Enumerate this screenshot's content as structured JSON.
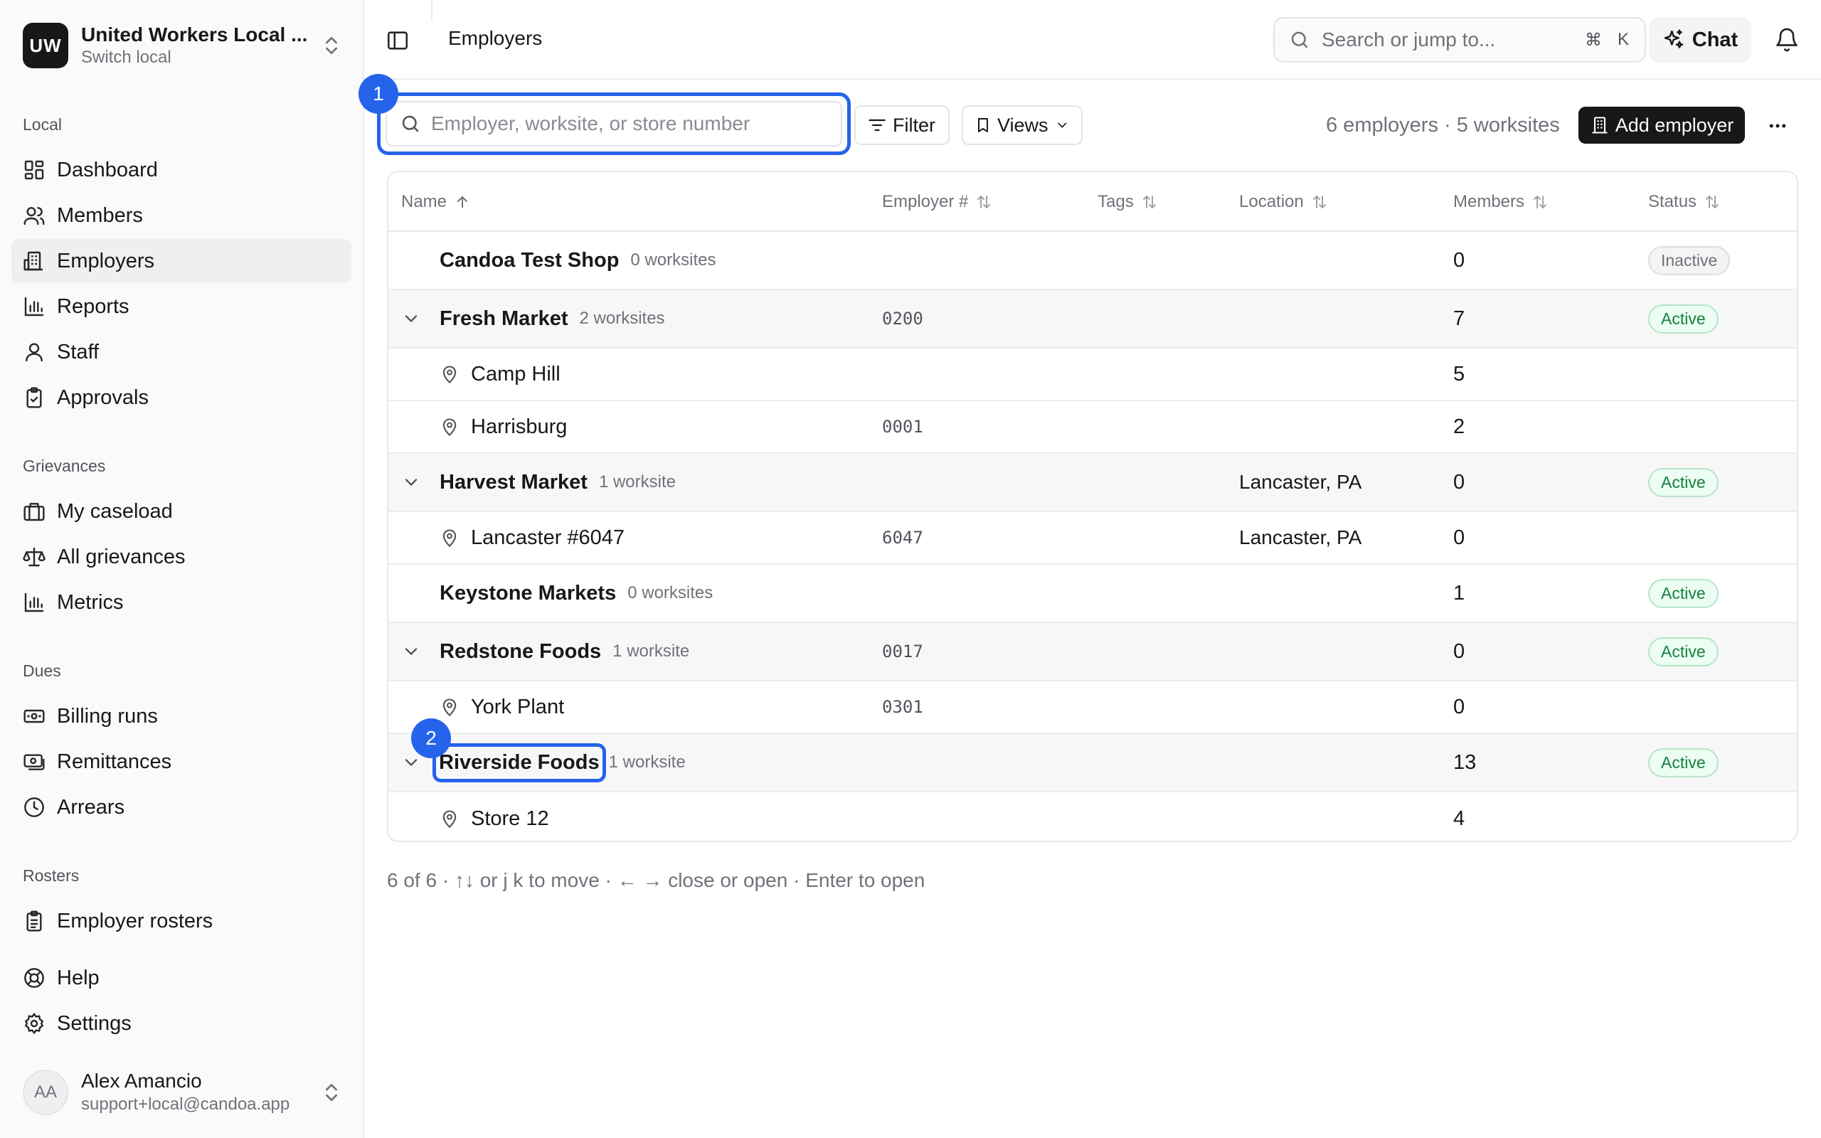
{
  "sidebar": {
    "org": {
      "logo_text": "UW",
      "name": "United Workers Local ...",
      "subtitle": "Switch local"
    },
    "groups": {
      "local": "Local",
      "grievances": "Grievances",
      "dues": "Dues",
      "rosters": "Rosters"
    },
    "items": {
      "dashboard": "Dashboard",
      "members": "Members",
      "employers": "Employers",
      "reports": "Reports",
      "staff": "Staff",
      "approvals": "Approvals",
      "my_caseload": "My caseload",
      "all_grievances": "All grievances",
      "metrics": "Metrics",
      "billing_runs": "Billing runs",
      "remittances": "Remittances",
      "arrears": "Arrears",
      "employer_rosters": "Employer rosters",
      "help": "Help",
      "settings": "Settings"
    },
    "active_item": "Employers",
    "user": {
      "initials": "AA",
      "name": "Alex Amancio",
      "email": "support+local@candoa.app"
    }
  },
  "header": {
    "title": "Employers",
    "search_placeholder": "Search or jump to...",
    "shortcut_cmd": "⌘",
    "shortcut_key": "K",
    "chat_label": "Chat"
  },
  "toolbar": {
    "search_placeholder": "Employer, worksite, or store number",
    "search_value": "",
    "filter_label": "Filter",
    "views_label": "Views",
    "counts": "6 employers · 5 worksites",
    "add_label": "Add employer"
  },
  "annotations": {
    "one": "1",
    "two": "2"
  },
  "table": {
    "columns": {
      "name": "Name",
      "employer_no": "Employer #",
      "tags": "Tags",
      "location": "Location",
      "members": "Members",
      "status": "Status"
    },
    "rows": [
      {
        "name": "Candoa Test Shop",
        "worksites": "0 worksites",
        "employer_no": "",
        "location": "",
        "members": "0",
        "status": "Inactive"
      },
      {
        "name": "Fresh Market",
        "worksites": "2 worksites",
        "employer_no": "0200",
        "location": "",
        "members": "7",
        "status": "Active"
      },
      {
        "name": "Camp Hill",
        "employer_no": "",
        "location": "",
        "members": "5"
      },
      {
        "name": "Harrisburg",
        "employer_no": "0001",
        "location": "",
        "members": "2"
      },
      {
        "name": "Harvest Market",
        "worksites": "1 worksite",
        "employer_no": "",
        "location": "Lancaster, PA",
        "members": "0",
        "status": "Active"
      },
      {
        "name": "Lancaster #6047",
        "employer_no": "6047",
        "location": "Lancaster, PA",
        "members": "0"
      },
      {
        "name": "Keystone Markets",
        "worksites": "0 worksites",
        "employer_no": "",
        "location": "",
        "members": "1",
        "status": "Active"
      },
      {
        "name": "Redstone Foods",
        "worksites": "1 worksite",
        "employer_no": "0017",
        "location": "",
        "members": "0",
        "status": "Active"
      },
      {
        "name": "York Plant",
        "employer_no": "0301",
        "location": "",
        "members": "0"
      },
      {
        "name": "Riverside Foods",
        "worksites": "1 worksite",
        "employer_no": "",
        "location": "",
        "members": "13",
        "status": "Active"
      },
      {
        "name": "Store 12",
        "employer_no": "",
        "location": "",
        "members": "4"
      }
    ]
  },
  "footer_hint": "6 of 6 · ↑↓ or j k to move · ← → close or open · Enter to open"
}
